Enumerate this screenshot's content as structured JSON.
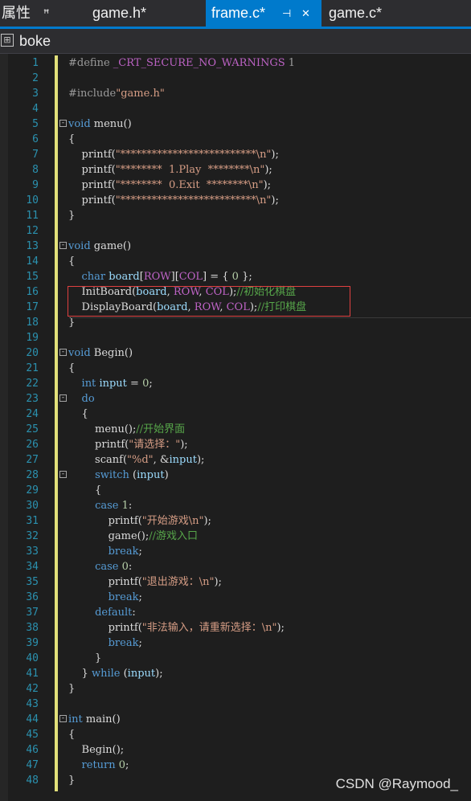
{
  "tabs": [
    {
      "label": "属性",
      "pin": "ꟸ",
      "active": false
    },
    {
      "label": "game.h*",
      "active": false
    },
    {
      "label": "frame.c*",
      "pin": "⊣",
      "close": "✕",
      "active": true
    },
    {
      "label": "game.c*",
      "active": false
    }
  ],
  "scope": {
    "icon": "scope-icon",
    "name": "boke"
  },
  "editor": {
    "lines": [
      {
        "n": "1",
        "html": "<span class='pp'>#define </span><span class='mac'>_CRT_SECURE_NO_WARNINGS</span><span class='pp'> 1</span>"
      },
      {
        "n": "2",
        "html": ""
      },
      {
        "n": "3",
        "html": "<span class='pp'>#include</span><span class='str'>\"game.h\"</span>"
      },
      {
        "n": "4",
        "html": ""
      },
      {
        "n": "5",
        "fold": "-",
        "html": "<span class='kw'>void</span> menu()"
      },
      {
        "n": "6",
        "html": "{"
      },
      {
        "n": "7",
        "html": "    printf(<span class='str'>\"**************************\\n\"</span>);"
      },
      {
        "n": "8",
        "html": "    printf(<span class='str'>\"********  1.Play  ********\\n\"</span>);"
      },
      {
        "n": "9",
        "html": "    printf(<span class='str'>\"********  0.Exit  ********\\n\"</span>);"
      },
      {
        "n": "10",
        "html": "    printf(<span class='str'>\"**************************\\n\"</span>);"
      },
      {
        "n": "11",
        "html": "}"
      },
      {
        "n": "12",
        "html": ""
      },
      {
        "n": "13",
        "fold": "-",
        "html": "<span class='kw'>void</span> game()"
      },
      {
        "n": "14",
        "html": "{"
      },
      {
        "n": "15",
        "html": "    <span class='kw'>char</span> <span class='var'>board</span>[<span class='mac'>ROW</span>][<span class='mac'>COL</span>] = { <span class='num'>0</span> };"
      },
      {
        "n": "16",
        "html": "    InitBoard(<span class='var'>board</span>, <span class='mac'>ROW</span>, <span class='mac'>COL</span>);<span class='cmt'>//初始化棋盘</span>"
      },
      {
        "n": "17",
        "html": "    DisplayBoard(<span class='var'>board</span>, <span class='mac'>ROW</span>, <span class='mac'>COL</span>);<span class='cmt'>//打印棋盘</span>"
      },
      {
        "n": "18",
        "html": "}"
      },
      {
        "n": "19",
        "html": ""
      },
      {
        "n": "20",
        "fold": "-",
        "html": "<span class='kw'>void</span> Begin()"
      },
      {
        "n": "21",
        "html": "{"
      },
      {
        "n": "22",
        "html": "    <span class='kw'>int</span> <span class='var'>input</span> = <span class='num'>0</span>;"
      },
      {
        "n": "23",
        "fold": "-",
        "html": "    <span class='kw'>do</span>"
      },
      {
        "n": "24",
        "html": "    {"
      },
      {
        "n": "25",
        "html": "        menu();<span class='cmt'>//开始界面</span>"
      },
      {
        "n": "26",
        "html": "        printf(<span class='str'>\"请选择：\"</span>);"
      },
      {
        "n": "27",
        "html": "        scanf(<span class='str'>\"%d\"</span>, &amp;<span class='var'>input</span>);"
      },
      {
        "n": "28",
        "fold": "-",
        "html": "        <span class='kw'>switch</span> (<span class='var'>input</span>)"
      },
      {
        "n": "29",
        "html": "        {"
      },
      {
        "n": "30",
        "html": "        <span class='kw'>case</span> <span class='num'>1</span>:"
      },
      {
        "n": "31",
        "html": "            printf(<span class='str'>\"开始游戏\\n\"</span>);"
      },
      {
        "n": "32",
        "html": "            game();<span class='cmt'>//游戏入口</span>"
      },
      {
        "n": "33",
        "html": "            <span class='kw'>break</span>;"
      },
      {
        "n": "34",
        "html": "        <span class='kw'>case</span> <span class='num'>0</span>:"
      },
      {
        "n": "35",
        "html": "            printf(<span class='str'>\"退出游戏：\\n\"</span>);"
      },
      {
        "n": "36",
        "html": "            <span class='kw'>break</span>;"
      },
      {
        "n": "37",
        "html": "        <span class='kw'>default</span>:"
      },
      {
        "n": "38",
        "html": "            printf(<span class='str'>\"非法输入，请重新选择：\\n\"</span>);"
      },
      {
        "n": "39",
        "html": "            <span class='kw'>break</span>;"
      },
      {
        "n": "40",
        "html": "        }"
      },
      {
        "n": "41",
        "html": "    } <span class='kw'>while</span> (<span class='var'>input</span>);"
      },
      {
        "n": "42",
        "html": "}"
      },
      {
        "n": "43",
        "html": ""
      },
      {
        "n": "44",
        "fold": "-",
        "html": "<span class='kw'>int</span> main()"
      },
      {
        "n": "45",
        "html": "{"
      },
      {
        "n": "46",
        "html": "    Begin();"
      },
      {
        "n": "47",
        "html": "    <span class='kw'>return</span> <span class='num'>0</span>;"
      },
      {
        "n": "48",
        "html": "}"
      }
    ]
  },
  "watermark": "CSDN @Raymood_",
  "colors": {
    "accent": "#007acc",
    "keyword": "#569cd6",
    "string": "#d69d85",
    "comment": "#57a64a",
    "macro": "#bd63c5",
    "line_number": "#2b91af",
    "change_bar": "#e2e07a",
    "highlight_box": "#e04040"
  }
}
